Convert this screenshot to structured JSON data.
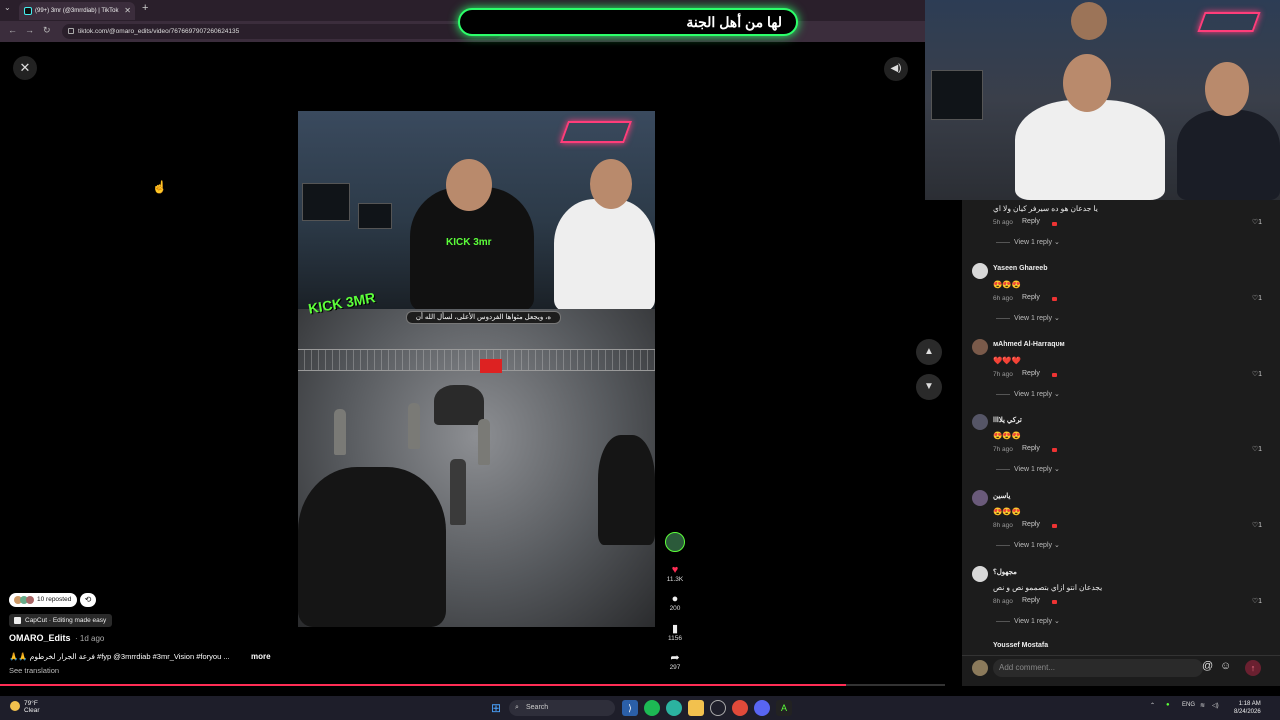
{
  "browser": {
    "tab_title": "(99+) 3mr (@3mrrdiab) | TikTok",
    "url": "tiktok.com/@omaro_edits/video/7676697907260624135"
  },
  "banner": {
    "text": "لها من أهل الجنة"
  },
  "video": {
    "caption": "ه، ويجعل مثواها الفردوس الأعلى، لسأل الله أن",
    "overlay_logo": "KICK 3MR",
    "shirt_text": "KICK 3mr"
  },
  "actions": {
    "likes": "11.3K",
    "comments": "200",
    "saves": "1156",
    "shares": "297"
  },
  "info": {
    "reposted": "10 reposted",
    "capcut": "CapCut · Editing made easy",
    "author": "OMARO_Edits",
    "ago": "· 1d ago",
    "description": "🙏🙏 فرعة الجرار لخرطوم #fyp @3mrrdiab #3mr_Vision #foryou ...",
    "more": "more",
    "translate": "See translation",
    "progress": 0.895
  },
  "comments": {
    "top_text": "يا جدعان هو ده سيرفر كيان ولا اي",
    "top_time": "5h ago",
    "reply_label": "Reply",
    "view_reply": "View 1 reply",
    "items": [
      {
        "name": "Yaseen Ghareeb",
        "text": "😍😍😍",
        "time": "6h ago",
        "likes": "1"
      },
      {
        "name": "ᴍAhmed Al-Harraqᴜᴍ",
        "text": "❤️❤️❤️",
        "time": "7h ago",
        "likes": "1"
      },
      {
        "name": "تركي يلاااا",
        "text": "😍😍😍",
        "time": "7h ago",
        "likes": "1"
      },
      {
        "name": "ياسين",
        "text": "😍😍😍",
        "time": "8h ago",
        "likes": "1"
      },
      {
        "name": "مجهول؟",
        "text": "يجدعان انتو ازاي بتصممو نص و نص",
        "time": "8h ago",
        "likes": "1"
      }
    ],
    "partial_name": "Youssef Mostafa",
    "add_placeholder": "Add comment..."
  },
  "taskbar": {
    "temp": "79°F",
    "condition": "Clear",
    "search": "Search",
    "lang": "ENG",
    "time": "1:18 AM",
    "date": "8/24/2026"
  }
}
